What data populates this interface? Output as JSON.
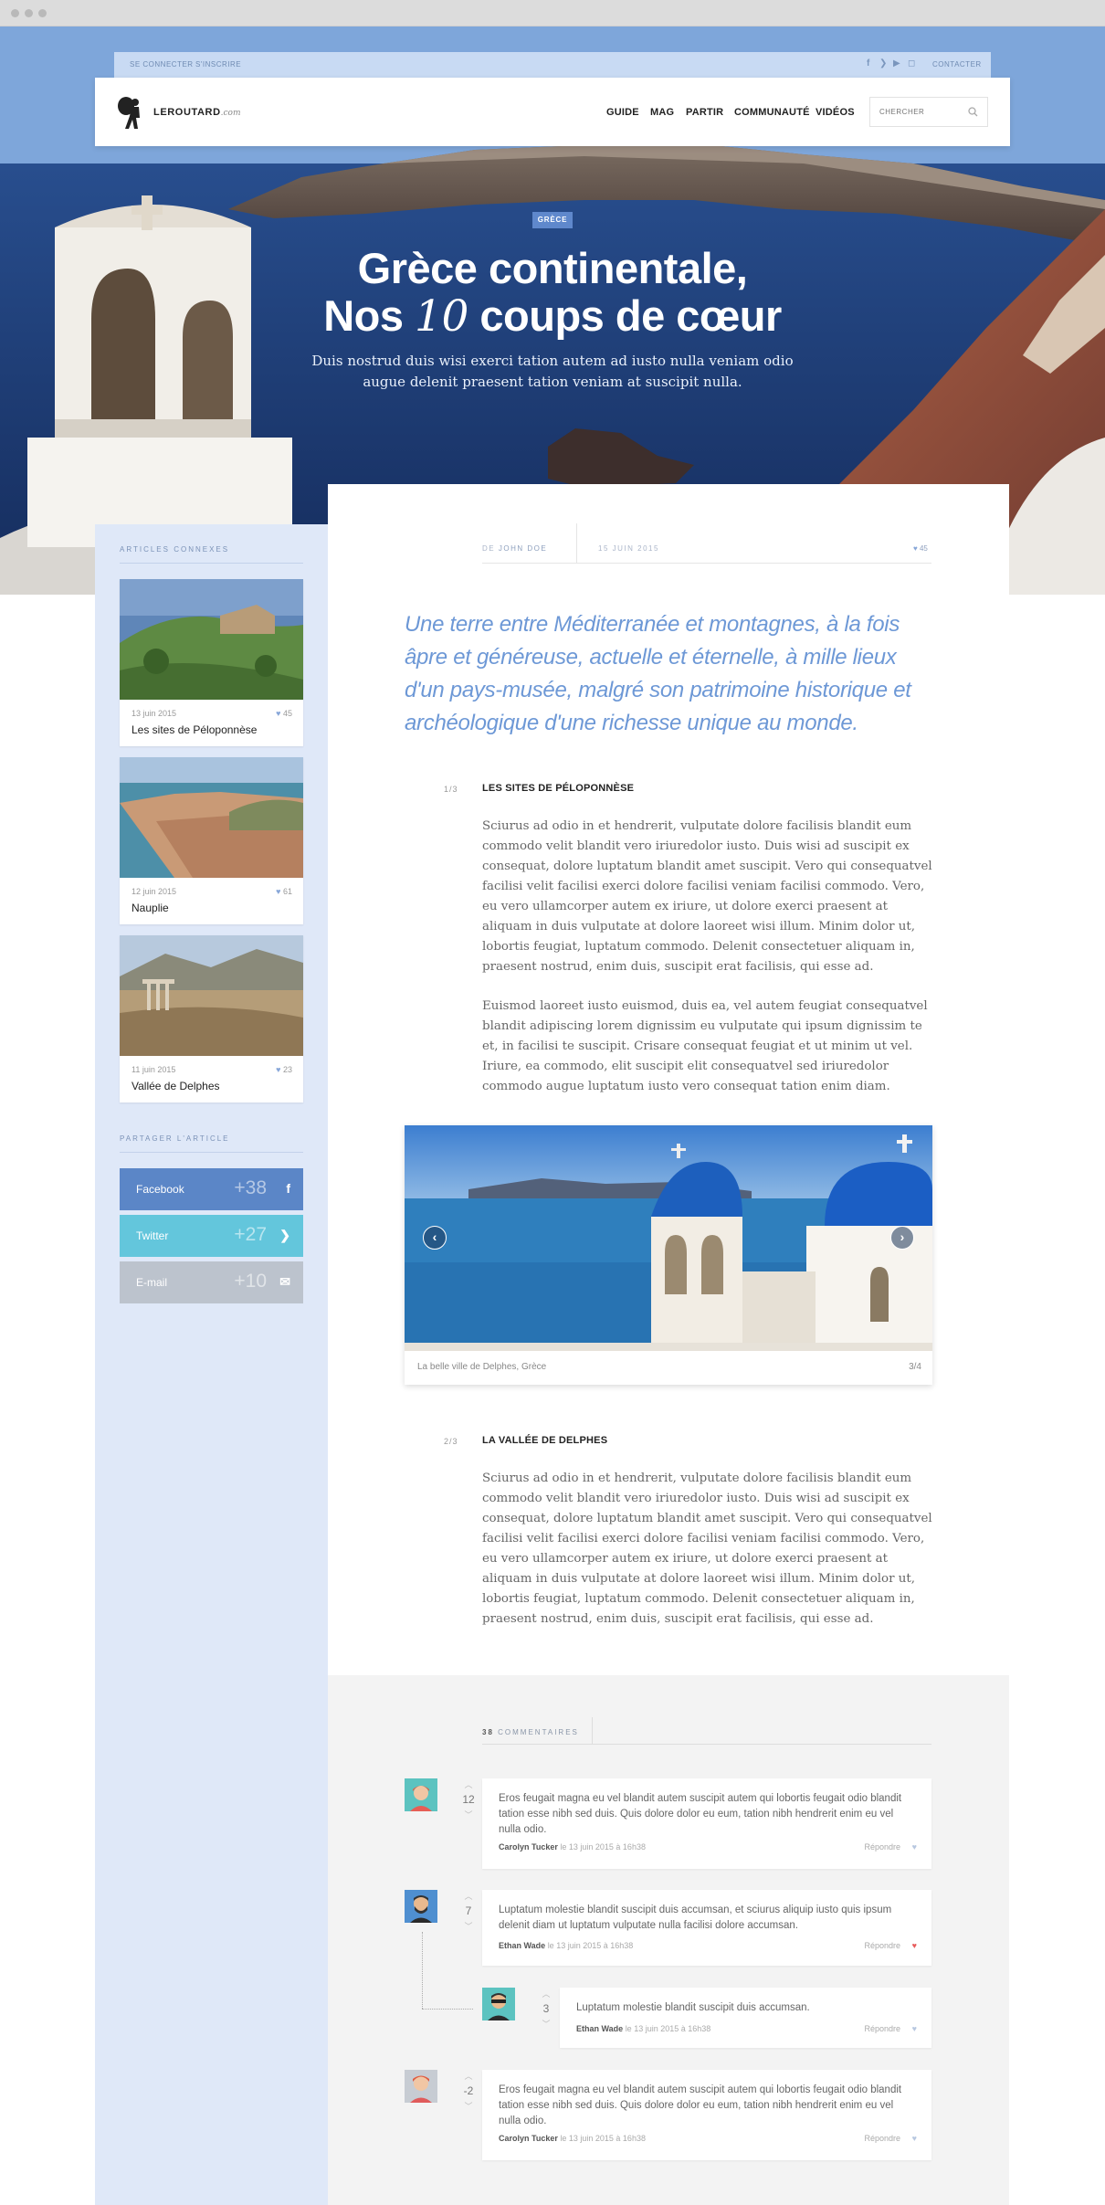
{
  "topbar": {
    "login": "SE CONNECTER",
    "signup": "S'INSCRIRE",
    "contact": "CONTACTER",
    "social": [
      "facebook-icon",
      "twitter-icon",
      "youtube-icon",
      "instagram-icon"
    ]
  },
  "logo": {
    "name": "LEROUTARD",
    "suffix": ".com"
  },
  "nav": {
    "items": [
      "GUIDE",
      "MAG",
      "PARTIR",
      "COMMUNAUTÉ",
      "VIDÉOS"
    ],
    "search_placeholder": "CHERCHER"
  },
  "hero": {
    "badge": "GRÈCE",
    "title_line1": "Grèce continentale,",
    "title_pre": "Nos ",
    "title_num": "10",
    "title_post": " coups de cœur",
    "subtitle": "Duis nostrud duis wisi exerci tation autem ad iusto nulla veniam odio augue delenit praesent tation veniam at suscipit nulla."
  },
  "sidebar": {
    "related_label": "ARTICLES CONNEXES",
    "articles": [
      {
        "date": "13 juin 2015",
        "likes": "45",
        "title": "Les sites de Péloponnèse"
      },
      {
        "date": "12 juin 2015",
        "likes": "61",
        "title": "Nauplie"
      },
      {
        "date": "11 juin 2015",
        "likes": "23",
        "title": "Vallée de Delphes"
      }
    ],
    "share_label": "PARTAGER L'ARTICLE",
    "share": [
      {
        "label": "Facebook",
        "count": "+38",
        "icon": "f",
        "color": "#5b86c7"
      },
      {
        "label": "Twitter",
        "count": "+27",
        "icon": "t",
        "color": "#63c6dc"
      },
      {
        "label": "E-mail",
        "count": "+10",
        "icon": "✉",
        "color": "#bcc3cd"
      }
    ]
  },
  "article": {
    "author_prefix": "DE ",
    "author": "JOHN DOE",
    "date": "15 JUIN 2015",
    "likes": "45",
    "lead": "Une terre entre Méditerranée et montagnes, à la fois âpre et généreuse, actuelle et éternelle, à mille lieux d'un pays-musée, malgré son patrimoine historique et archéologique d'une richesse unique au monde.",
    "sections": [
      {
        "num": "1/3",
        "title": "LES SITES DE PÉLOPONNÈSE",
        "paragraphs": [
          "Sciurus ad odio in et hendrerit, vulputate dolore facilisis blandit eum commodo velit blandit vero iriuredolor iusto. Duis wisi ad suscipit ex consequat, dolore luptatum blandit amet suscipit. Vero qui consequatvel facilisi velit facilisi exerci dolore facilisi veniam facilisi commodo. Vero, eu vero ullamcorper autem ex iriure, ut dolore exerci praesent at aliquam in duis vulputate at dolore laoreet wisi illum. Minim dolor ut, lobortis feugiat, luptatum commodo. Delenit consectetuer aliquam in, praesent nostrud, enim duis, suscipit erat facilisis, qui esse ad.",
          "Euismod laoreet iusto euismod, duis ea, vel autem feugiat consequatvel blandit adipiscing lorem dignissim eu vulputate qui ipsum dignissim te et, in facilisi te suscipit. Crisare consequat feugiat et ut minim ut vel. Iriure, ea commodo, elit suscipit elit consequatvel sed iriuredolor commodo augue luptatum iusto vero consequat tation enim diam."
        ]
      },
      {
        "num": "2/3",
        "title": "LA VALLÉE DE DELPHES",
        "paragraphs": [
          "Sciurus ad odio in et hendrerit, vulputate dolore facilisis blandit eum commodo velit blandit vero iriuredolor iusto. Duis wisi ad suscipit ex consequat, dolore luptatum blandit amet suscipit. Vero qui consequatvel facilisi velit facilisi exerci dolore facilisi veniam facilisi commodo. Vero, eu vero ullamcorper autem ex iriure, ut dolore exerci praesent at aliquam in duis vulputate at dolore laoreet wisi illum. Minim dolor ut, lobortis feugiat, luptatum commodo. Delenit consectetuer aliquam in, praesent nostrud, enim duis, suscipit erat facilisis, qui esse ad."
        ]
      }
    ],
    "slider": {
      "caption": "La belle ville de Delphes, Grèce",
      "counter": "3/4",
      "prev": "‹",
      "next": "›"
    }
  },
  "comments": {
    "count": "38",
    "label": "COMMENTAIRES",
    "items": [
      {
        "votes": "12",
        "text": "Eros feugait magna eu vel blandit autem suscipit autem qui lobortis feugait odio blandit tation esse nibh sed duis. Quis dolore dolor eu eum, tation nibh hendrerit enim eu vel nulla odio.",
        "author": "Carolyn Tucker",
        "date": "le 13 juin 2015 à 16h38",
        "reply": "Répondre",
        "liked": false
      },
      {
        "votes": "7",
        "text": "Luptatum molestie blandit suscipit duis accumsan, et sciurus aliquip iusto quis ipsum delenit diam ut luptatum vulputate nulla facilisi dolore accumsan.",
        "author": "Ethan Wade",
        "date": "le 13 juin 2015 à 16h38",
        "reply": "Répondre",
        "liked": true
      },
      {
        "votes": "3",
        "text": "Luptatum molestie blandit suscipit duis accumsan.",
        "author": "Ethan Wade",
        "date": "le 13 juin 2015 à 16h38",
        "reply": "Répondre",
        "liked": false
      },
      {
        "votes": "-2",
        "text": "Eros feugait magna eu vel blandit autem suscipit autem qui lobortis feugait odio blandit tation esse nibh sed duis. Quis dolore dolor eu eum, tation nibh hendrerit enim eu vel nulla odio.",
        "author": "Carolyn Tucker",
        "date": "le 13 juin 2015 à 16h38",
        "reply": "Répondre",
        "liked": false
      }
    ]
  }
}
